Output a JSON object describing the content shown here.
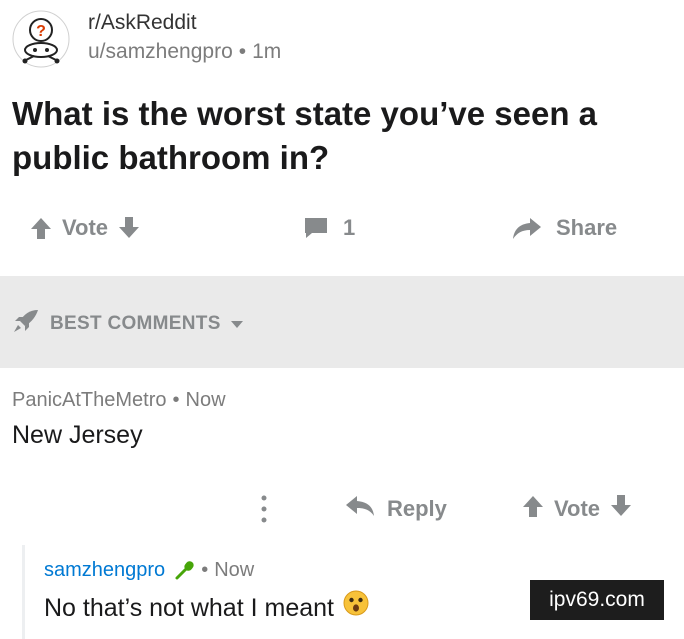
{
  "post": {
    "subreddit": "r/AskReddit",
    "author": "u/samzhengpro",
    "separator": "•",
    "age": "1m",
    "title": "What is the worst state you’ve seen a public bathroom in?",
    "vote_label": "Vote",
    "comment_count": "1",
    "share_label": "Share"
  },
  "sort": {
    "label": "BEST COMMENTS"
  },
  "comment": {
    "author": "PanicAtTheMetro",
    "separator": "•",
    "age": "Now",
    "body": "New Jersey",
    "reply_label": "Reply",
    "vote_label": "Vote"
  },
  "reply": {
    "author": "samzhengpro",
    "separator": "•",
    "age": "Now",
    "body": "No that’s not what I meant",
    "op_icon": "microphone-icon",
    "emoji": "astonished-face-emoji"
  },
  "watermark": {
    "text": "ipv69.com"
  },
  "colors": {
    "muted": "#878a8c",
    "band": "#eaeaea",
    "username_link": "#0079d3",
    "text": "#1a1a1b"
  }
}
